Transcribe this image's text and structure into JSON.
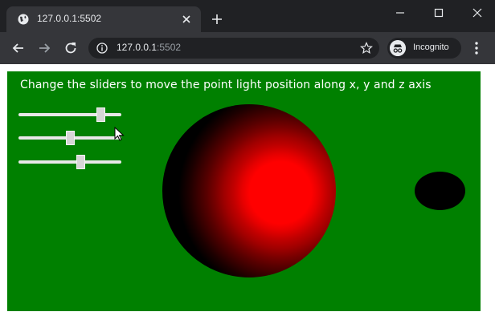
{
  "browser": {
    "tab_title": "127.0.0.1:5502",
    "url_host": "127.0.0.1",
    "url_port": ":5502",
    "profile_label": "Incognito",
    "icons": [
      "globe-icon",
      "close-icon",
      "plus-icon",
      "minimize-icon",
      "maximize-icon",
      "window-close-icon",
      "back-arrow-icon",
      "forward-arrow-icon",
      "reload-icon",
      "info-icon",
      "star-icon",
      "incognito-icon",
      "kebab-menu-icon"
    ]
  },
  "scene": {
    "instructions": "Change the sliders to move the point light position along x, y and z axis",
    "background_color": "#008000",
    "sphere_highlight_color": "#ff0000",
    "sliders": [
      {
        "axis": "x",
        "value": 0.8
      },
      {
        "axis": "y",
        "value": 0.5
      },
      {
        "axis": "z",
        "value": 0.6
      }
    ]
  }
}
